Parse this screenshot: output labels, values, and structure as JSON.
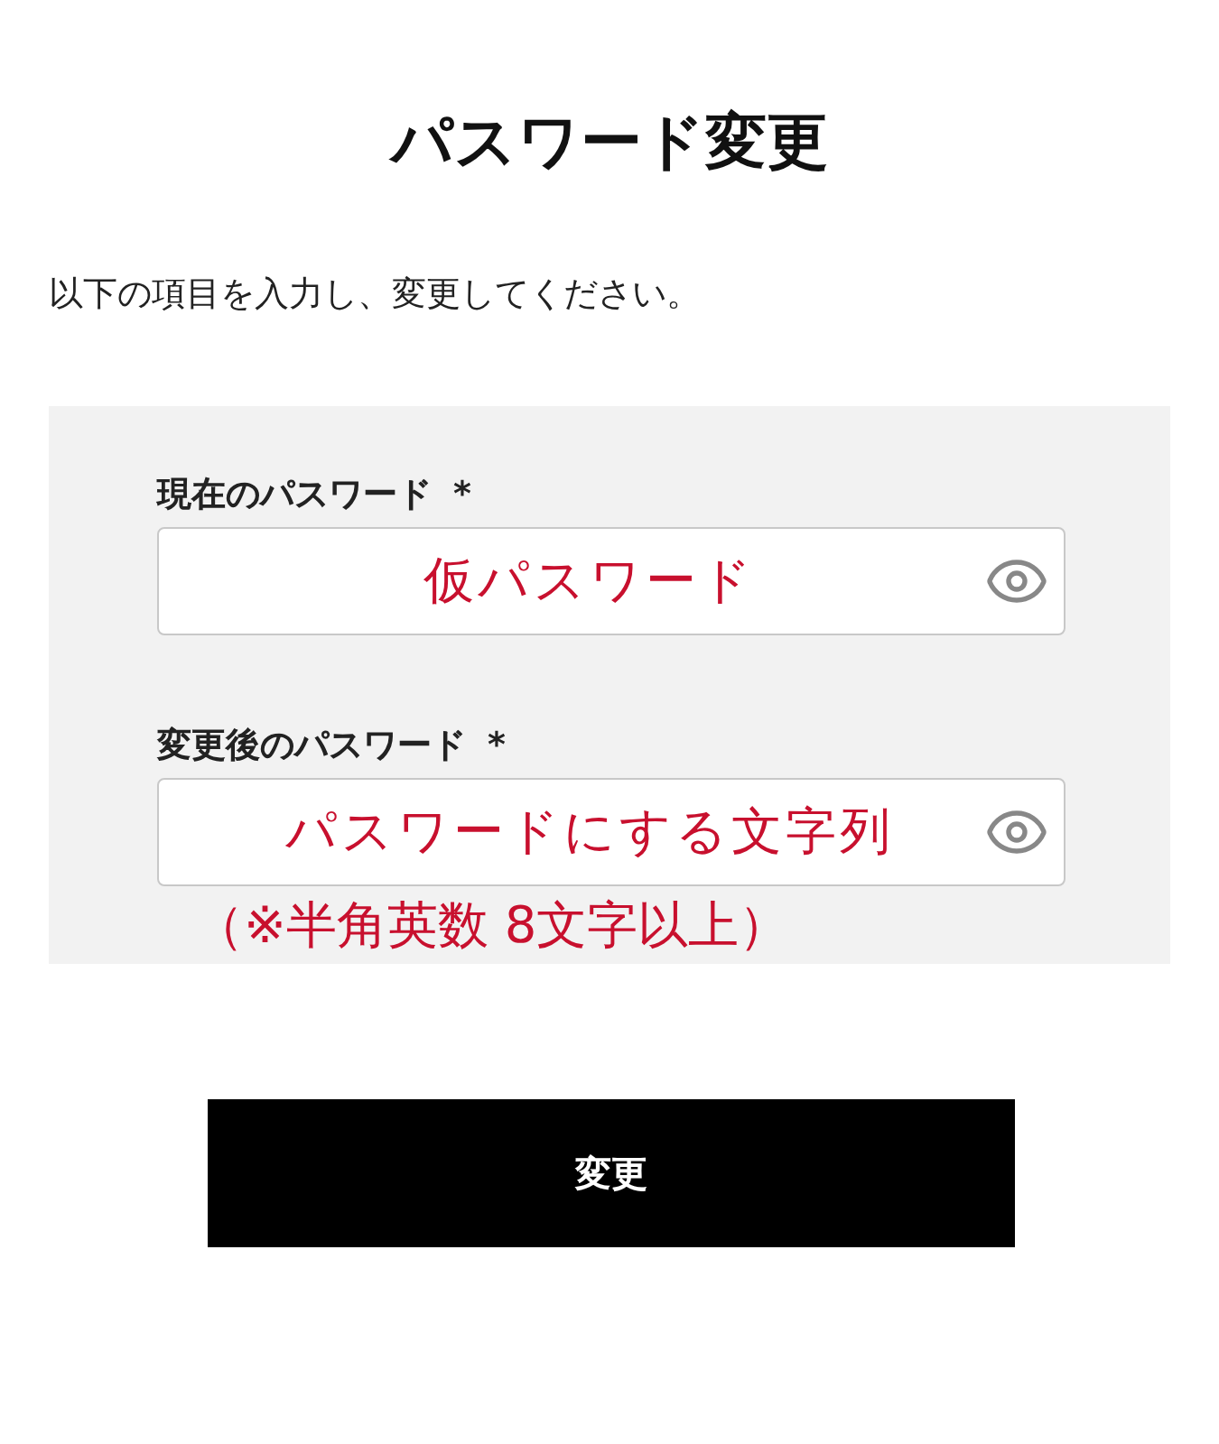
{
  "title": "パスワード変更",
  "instruction": "以下の項目を入力し、変更してください。",
  "fields": [
    {
      "label": "現在のパスワード",
      "required_mark": "*",
      "value": "仮パスワード"
    },
    {
      "label": "変更後のパスワード",
      "required_mark": "*",
      "value": "パスワードにする文字列"
    }
  ],
  "note": "（※半角英数 8文字以上）",
  "submit_button": "変更"
}
